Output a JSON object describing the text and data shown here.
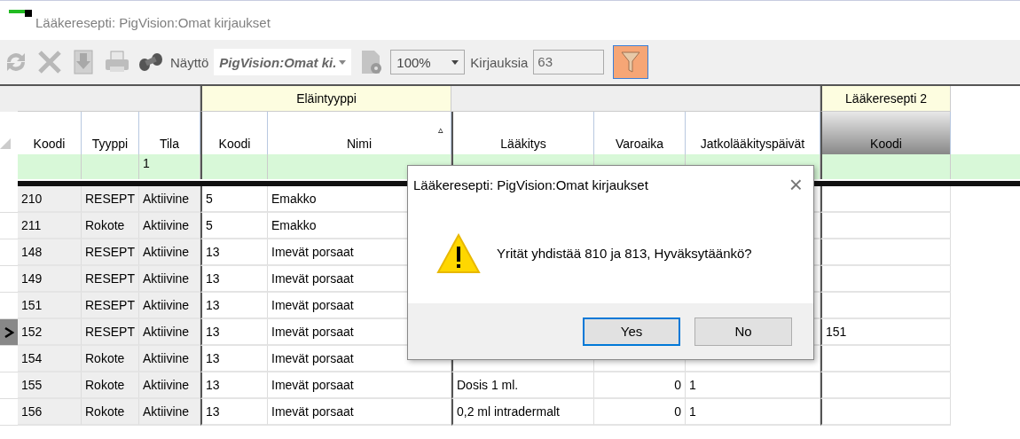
{
  "window": {
    "title": "Lääkeresepti: PigVision:Omat kirjaukset"
  },
  "toolbar": {
    "view_label": "Näyttö",
    "view_value": "PigVision:Omat ki.",
    "zoom_value": "100%",
    "count_label": "Kirjauksia",
    "count_value": "63",
    "filter_on": true
  },
  "table": {
    "groups": [
      "Eläintyyppi",
      "Lääkeresepti 2"
    ],
    "columns": [
      {
        "label": "Koodi",
        "selected": false
      },
      {
        "label": "Tyyppi",
        "selected": false
      },
      {
        "label": "Tila",
        "selected": false
      },
      {
        "label": "Koodi",
        "selected": false
      },
      {
        "label": "Nimi",
        "selected": false,
        "sort": "▵"
      },
      {
        "label": "Lääkitys",
        "selected": false
      },
      {
        "label": "Varoaika",
        "selected": false
      },
      {
        "label": "Jatkolääkityspäivät",
        "selected": false
      },
      {
        "label": "Koodi",
        "selected": true
      }
    ],
    "filter": {
      "tila": "1"
    },
    "rows": [
      {
        "current": false,
        "cells": [
          "210",
          "RESEPT",
          "Aktiivine",
          "5",
          "Emakko",
          "",
          "",
          "",
          ""
        ]
      },
      {
        "current": false,
        "cells": [
          "211",
          "Rokote",
          "Aktiivine",
          "5",
          "Emakko",
          "",
          "",
          "",
          ""
        ]
      },
      {
        "current": false,
        "cells": [
          "148",
          "RESEPT",
          "Aktiivine",
          "13",
          "Imevät porsaat",
          "",
          "",
          "",
          ""
        ]
      },
      {
        "current": false,
        "cells": [
          "149",
          "RESEPT",
          "Aktiivine",
          "13",
          "Imevät porsaat",
          "",
          "",
          "",
          ""
        ]
      },
      {
        "current": false,
        "cells": [
          "151",
          "RESEPT",
          "Aktiivine",
          "13",
          "Imevät porsaat",
          "",
          "",
          "",
          ""
        ]
      },
      {
        "current": true,
        "cells": [
          "152",
          "RESEPT",
          "Aktiivine",
          "13",
          "Imevät porsaat",
          "",
          "",
          "",
          "151"
        ]
      },
      {
        "current": false,
        "cells": [
          "154",
          "Rokote",
          "Aktiivine",
          "13",
          "Imevät porsaat",
          "",
          "",
          "",
          ""
        ]
      },
      {
        "current": false,
        "cells": [
          "155",
          "Rokote",
          "Aktiivine",
          "13",
          "Imevät porsaat",
          "Dosis 1 ml.",
          "0",
          "1",
          ""
        ]
      },
      {
        "current": false,
        "cells": [
          "156",
          "Rokote",
          "Aktiivine",
          "13",
          "Imevät porsaat",
          "0,2 ml intradermalt",
          "0",
          "1",
          ""
        ]
      }
    ]
  },
  "dialog": {
    "title": "Lääkeresepti: PigVision:Omat kirjaukset",
    "close": "×",
    "message": "Yrität yhdistää 810 ja 813, Hyväksytäänkö?",
    "buttons": [
      {
        "label": "Yes",
        "selected": true
      },
      {
        "label": "No",
        "selected": false
      }
    ]
  }
}
